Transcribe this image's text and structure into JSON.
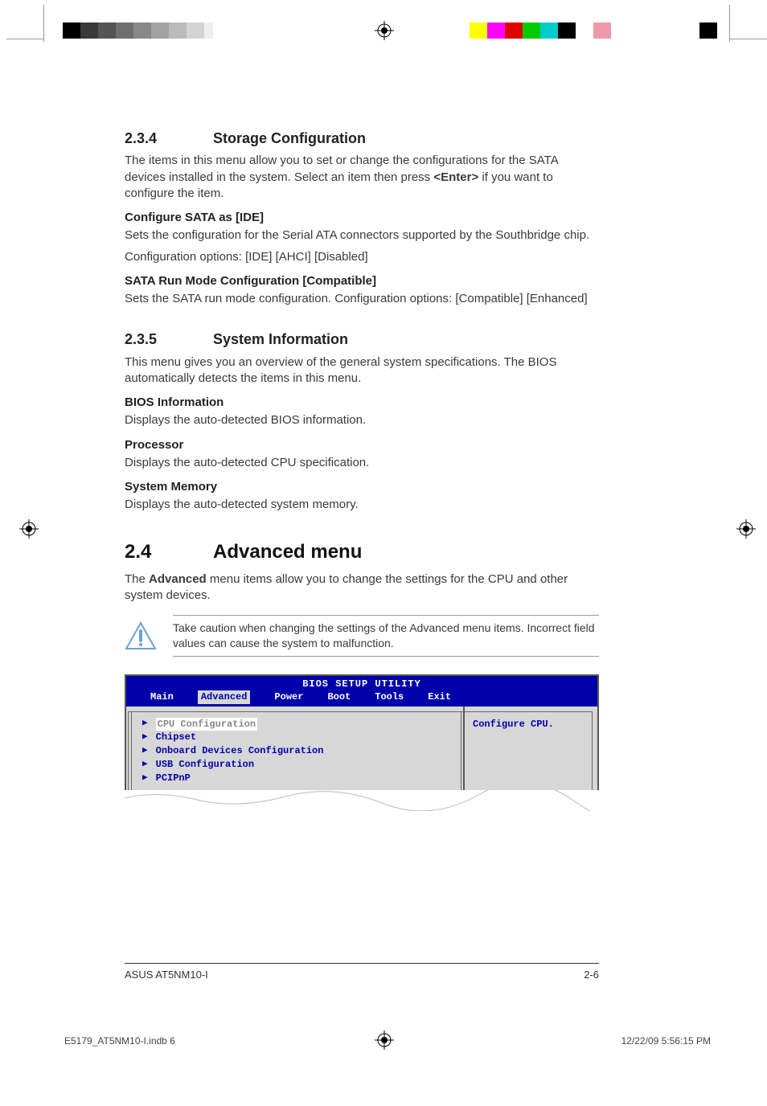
{
  "sections": {
    "s234": {
      "num": "2.3.4",
      "title": "Storage Configuration",
      "intro_a": "The items in this menu allow you to set or change the configurations for the SATA devices installed in the system. Select an item then press ",
      "intro_key": "<Enter>",
      "intro_b": " if you want to configure the item.",
      "sub1_title": "Configure SATA as [IDE]",
      "sub1_p1": "Sets the configuration for the Serial ATA connectors supported by the Southbridge chip.",
      "sub1_p2": "Configuration options: [IDE] [AHCI] [Disabled]",
      "sub2_title": "SATA Run Mode Configuration [Compatible]",
      "sub2_p": "Sets the SATA run mode configuration. Configuration options: [Compatible] [Enhanced]"
    },
    "s235": {
      "num": "2.3.5",
      "title": "System Information",
      "intro": "This menu gives you an overview of the general system specifications. The BIOS automatically detects the items in this menu.",
      "sub1_title": "BIOS Information",
      "sub1_p": "Displays the auto-detected BIOS information.",
      "sub2_title": "Processor",
      "sub2_p": "Displays the auto-detected CPU specification.",
      "sub3_title": "System Memory",
      "sub3_p": "Displays the auto-detected system memory."
    },
    "s24": {
      "num": "2.4",
      "title": "Advanced menu",
      "intro_a": "The ",
      "intro_bold": "Advanced",
      "intro_b": " menu items allow you to change the settings for the CPU and other system devices.",
      "note": "Take caution when changing the settings of the Advanced menu items. Incorrect field values can cause the system to malfunction."
    }
  },
  "bios": {
    "title": "BIOS SETUP UTILITY",
    "tabs": [
      "Main",
      "Advanced",
      "Power",
      "Boot",
      "Tools",
      "Exit"
    ],
    "active_tab_index": 1,
    "items": [
      "CPU Configuration",
      "Chipset",
      "Onboard Devices Configuration",
      "USB Configuration",
      "PCIPnP"
    ],
    "selected_item_index": 0,
    "help_text": "Configure CPU."
  },
  "footer": {
    "left": "ASUS AT5NM10-I",
    "right": "2-6"
  },
  "print_footer": {
    "file": "E5179_AT5NM10-I.indb   6",
    "date": "12/22/09   5:56:15 PM"
  },
  "colorbar_left": [
    "#000",
    "#444",
    "#666",
    "#888",
    "#aaa",
    "#ccc",
    "#eee",
    "#fff",
    "#fff",
    "#fff",
    "#fff",
    "#fff",
    "#fff",
    "#fff"
  ],
  "colorbar_right": [
    "#fff",
    "#ff0",
    "#f0f",
    "#d00",
    "#0c0",
    "#0aa",
    "#000",
    "#fff",
    "#e8a",
    "#fff",
    "#fff",
    "#fff",
    "#fff",
    "#000"
  ]
}
